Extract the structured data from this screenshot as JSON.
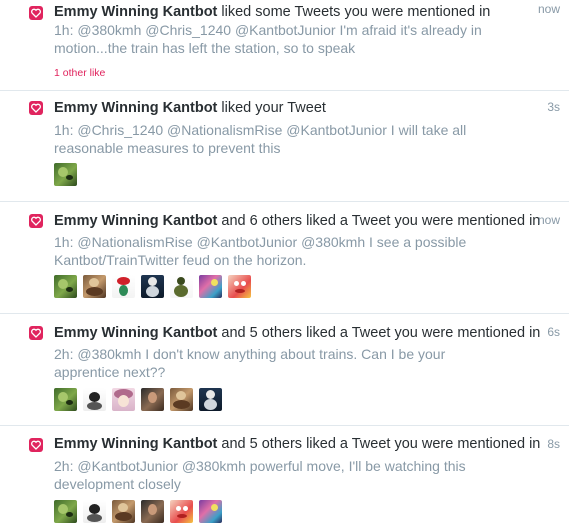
{
  "notifications": [
    {
      "name": "Emmy Winning Kantbot",
      "action": "liked some Tweets you were mentioned in",
      "time": "now",
      "body": "1h: @380kmh @Chris_1240 @KantbotJunior I'm afraid it's already in motion...the train has left the station, so to speak",
      "likes_text": "1 other like",
      "avatars": []
    },
    {
      "name": "Emmy Winning Kantbot",
      "action": "liked your Tweet",
      "time": "3s",
      "body": "1h: @Chris_1240 @NationalismRise @KantbotJunior I will take all reasonable measures to prevent this",
      "likes_text": "",
      "avatars": [
        "pepe"
      ]
    },
    {
      "name": "Emmy Winning Kantbot",
      "action": "and 6 others liked a Tweet you were mentioned in",
      "time": "now",
      "body": "1h: @NationalismRise @KantbotJunior @380kmh I see a possible Kantbot/TrainTwitter feud on the horizon.",
      "likes_text": "",
      "avatars": [
        "pepe",
        "painting",
        "red-cap",
        "robot",
        "figure",
        "abstract",
        "cartoon"
      ]
    },
    {
      "name": "Emmy Winning Kantbot",
      "action": "and 5 others liked a Tweet you were mentioned in",
      "time": "6s",
      "body": "2h: @380kmh I don't know anything about trains. Can I be your apprentice next??",
      "likes_text": "",
      "avatars": [
        "pepe",
        "sketch",
        "anime",
        "portrait",
        "painting",
        "robot"
      ]
    },
    {
      "name": "Emmy Winning Kantbot",
      "action": "and 5 others liked a Tweet you were mentioned in",
      "time": "8s",
      "body": "2h: @KantbotJunior @380kmh powerful move, I'll be watching this development closely",
      "likes_text": "",
      "avatars": [
        "pepe",
        "sketch",
        "painting",
        "portrait",
        "cartoon",
        "abstract"
      ]
    }
  ],
  "colors": {
    "heart": "#e0245e",
    "muted": "#8899a6",
    "text": "#292f33",
    "divider": "#e1e8ed"
  }
}
